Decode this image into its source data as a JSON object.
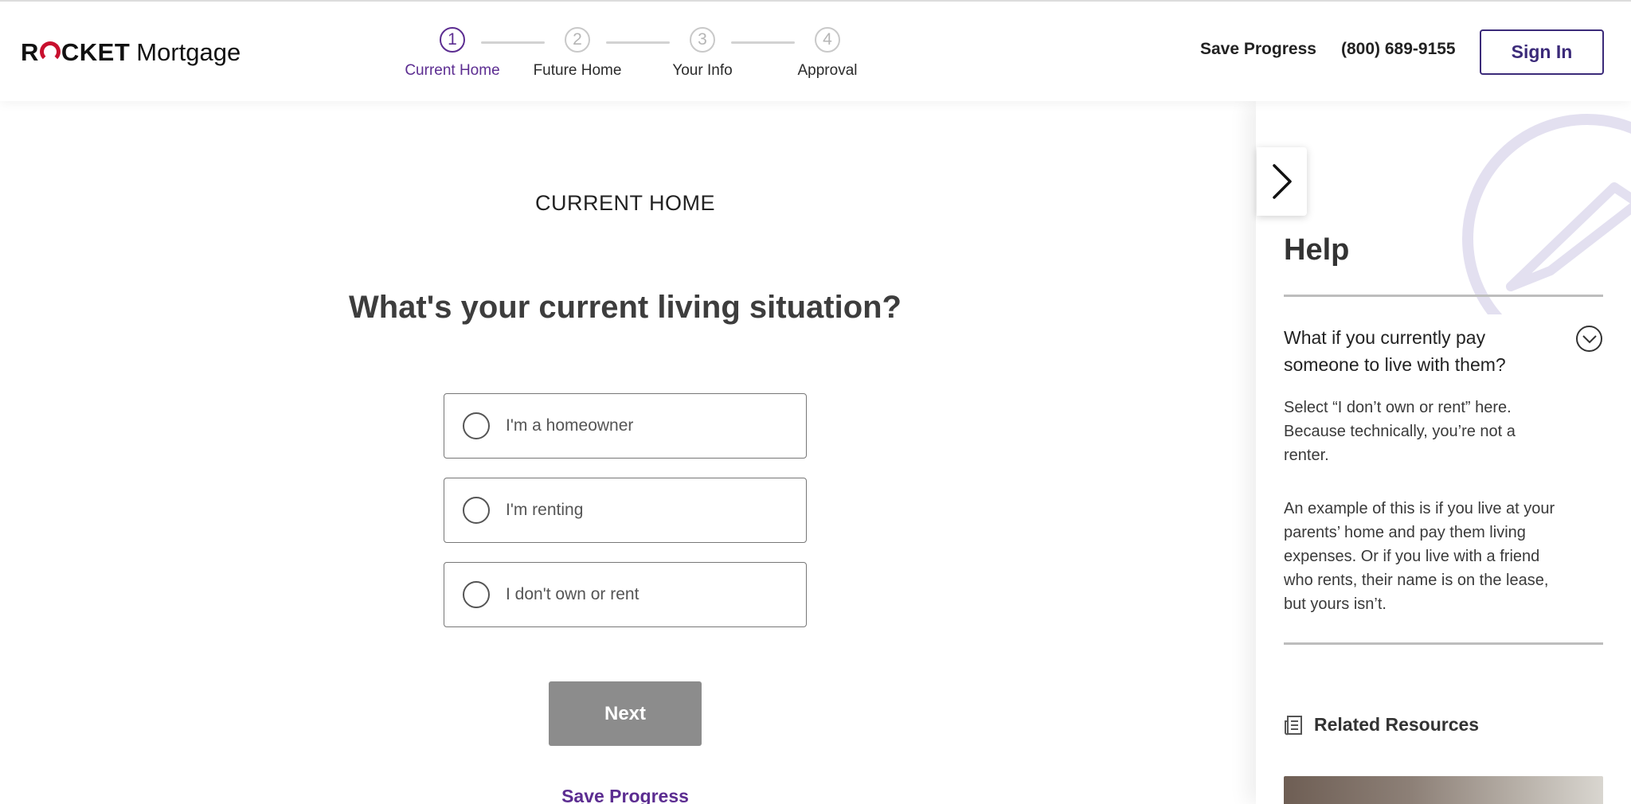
{
  "brand": {
    "name_bold": "ROCKET",
    "name_light": "Mortgage",
    "accent": "#c8102e"
  },
  "stepper": {
    "steps": [
      {
        "number": "1",
        "label": "Current Home"
      },
      {
        "number": "2",
        "label": "Future Home"
      },
      {
        "number": "3",
        "label": "Your Info"
      },
      {
        "number": "4",
        "label": "Approval"
      }
    ],
    "active_index": 0,
    "active_color": "#5c2d91"
  },
  "header": {
    "save_progress": "Save Progress",
    "phone": "(800) 689-9155",
    "sign_in": "Sign In"
  },
  "main": {
    "eyebrow": "CURRENT HOME",
    "question": "What's your current living situation?",
    "options": [
      {
        "label": "I'm a homeowner"
      },
      {
        "label": "I'm renting"
      },
      {
        "label": "I don't own or rent"
      }
    ],
    "next_label": "Next",
    "save_progress": "Save Progress"
  },
  "help": {
    "title": "Help",
    "collapse_icon": "chevron-right-icon",
    "faq": {
      "question": "What if you currently pay someone to live with them?",
      "answer_p1": "Select “I don’t own or rent” here. Because technically, you’re not a renter.",
      "answer_p2": "An example of this is if you live at your parents’ home and pay them living expenses. Or if you live with a friend who rents, their name is on the lease, but yours isn’t.",
      "toggle_icon": "chevron-down-icon"
    },
    "related_label": "Related Resources",
    "related_icon": "newspaper-icon"
  }
}
